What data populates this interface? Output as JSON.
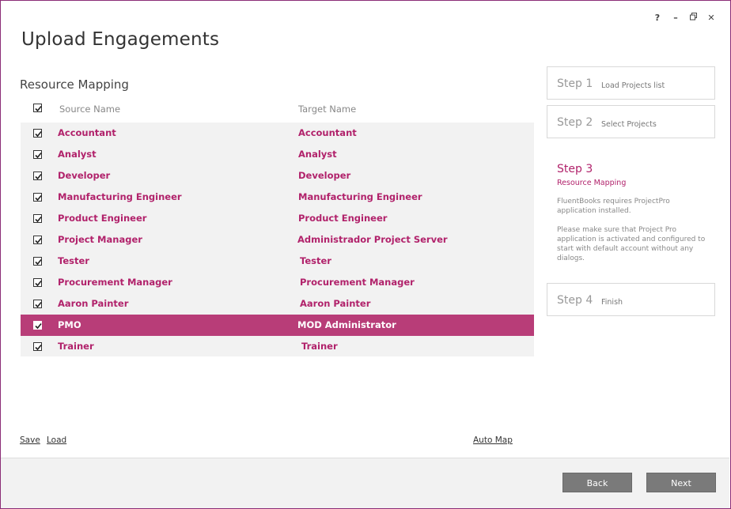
{
  "window": {
    "title": "Upload Engagements",
    "controls": {
      "help": "?",
      "minimize": "–",
      "restore": "🗗",
      "close": "✕"
    }
  },
  "mapping": {
    "section_title": "Resource Mapping",
    "header": {
      "source": "Source Name",
      "target": "Target Name",
      "all_checked": true
    },
    "rows": [
      {
        "source": "Accountant",
        "target": "Accountant",
        "checked": true,
        "selected": false
      },
      {
        "source": "Analyst",
        "target": "Analyst",
        "checked": true,
        "selected": false
      },
      {
        "source": "Developer",
        "target": "Developer",
        "checked": true,
        "selected": false
      },
      {
        "source": "Manufacturing Engineer",
        "target": "Manufacturing Engineer",
        "checked": true,
        "selected": false
      },
      {
        "source": "Product Engineer",
        "target": "Product Engineer",
        "checked": true,
        "selected": false
      },
      {
        "source": "Project Manager",
        "target": "Administrador Project Server",
        "checked": true,
        "selected": false
      },
      {
        "source": "Tester",
        "target": "Tester",
        "checked": true,
        "selected": false
      },
      {
        "source": "Procurement Manager",
        "target": "Procurement Manager",
        "checked": true,
        "selected": false
      },
      {
        "source": "Aaron Painter",
        "target": "Aaron Painter",
        "checked": true,
        "selected": false
      },
      {
        "source": "PMO",
        "target": "MOD Administrator",
        "checked": true,
        "selected": true
      },
      {
        "source": "Trainer",
        "target": "Trainer",
        "checked": true,
        "selected": false
      }
    ],
    "links": {
      "save": "Save",
      "load": "Load",
      "auto_map": "Auto Map"
    }
  },
  "steps": {
    "step1": {
      "num": "Step 1",
      "label": "Load Projects list"
    },
    "step2": {
      "num": "Step 2",
      "label": "Select Projects"
    },
    "step3": {
      "num": "Step 3",
      "label": "Resource Mapping",
      "desc1": "FluentBooks requires ProjectPro application installed.",
      "desc2": "Please make sure that Project Pro application is activated and configured to start with default account without any dialogs."
    },
    "step4": {
      "num": "Step 4",
      "label": "Finish"
    }
  },
  "footer": {
    "back": "Back",
    "next": "Next"
  },
  "colors": {
    "accent": "#b1226b",
    "selected_row": "#b83d78",
    "button": "#7a7a7a"
  }
}
